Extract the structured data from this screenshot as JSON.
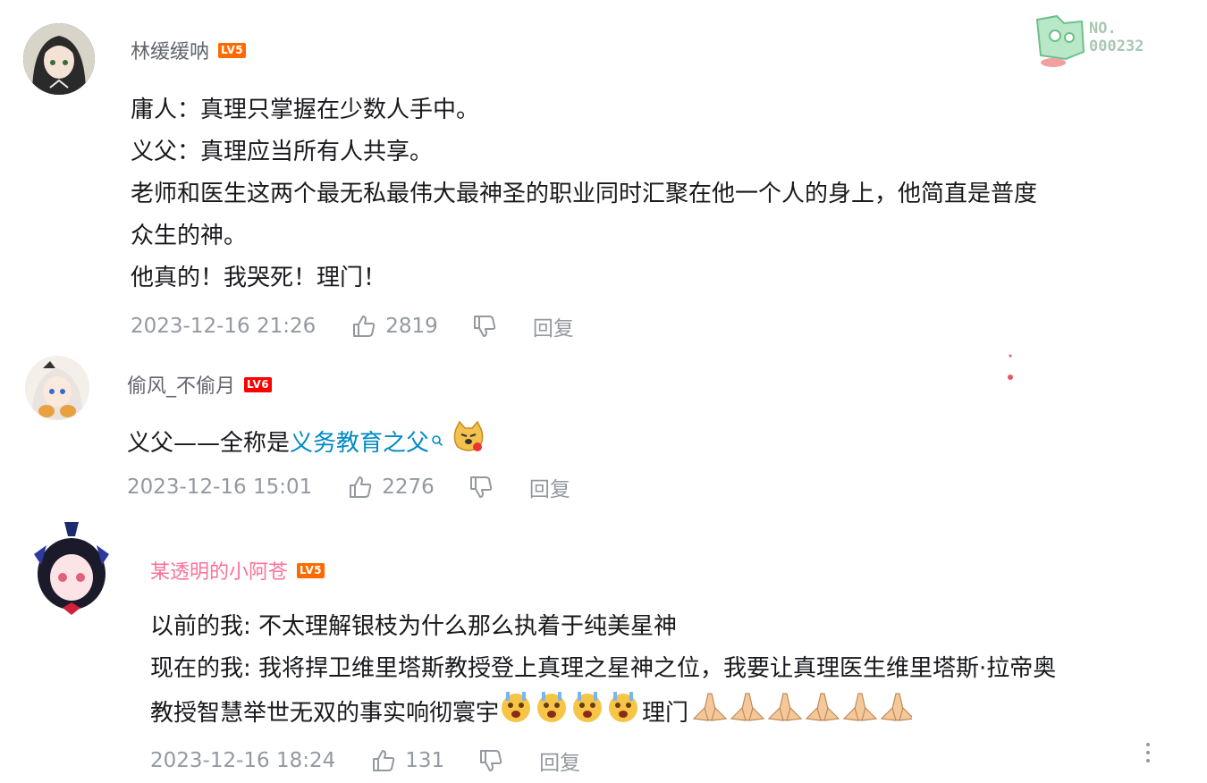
{
  "badge": {
    "label": "NO.",
    "number": "000232"
  },
  "comments": [
    {
      "username": "林缓缓呐",
      "level": "LV5",
      "level_color": "#ff6a00",
      "username_color": "#61666d",
      "lines": [
        "庸人：真理只掌握在少数人手中。",
        "义父：真理应当所有人共享。",
        "老师和医生这两个最无私最伟大最神圣的职业同时汇聚在他一个人的身上，他简直是普度",
        "众生的神。",
        "他真的！我哭死！理门！"
      ],
      "time": "2023-12-16 21:26",
      "likes": "2819",
      "reply": "回复"
    },
    {
      "username": "偷风_不偷月",
      "level": "LV6",
      "level_color": "#ff0000",
      "username_color": "#61666d",
      "line_prefix": "义父——全称是",
      "line_link": "义务教育之父",
      "time": "2023-12-16 15:01",
      "likes": "2276",
      "reply": "回复"
    },
    {
      "username": "某透明的小阿苍",
      "level": "LV5",
      "level_color": "#ff6a00",
      "username_color": "#fb7299",
      "lines": [
        "以前的我: 不太理解银枝为什么那么执着于纯美星神",
        "现在的我: 我将捍卫维里塔斯教授登上真理之星神之位，我要让真理医生维里塔斯·拉帝奥",
        "教授智慧举世无双的事实响彻寰宇"
      ],
      "line3_suffix": "理门",
      "time": "2023-12-16 18:24",
      "likes": "131",
      "reply": "回复"
    }
  ]
}
